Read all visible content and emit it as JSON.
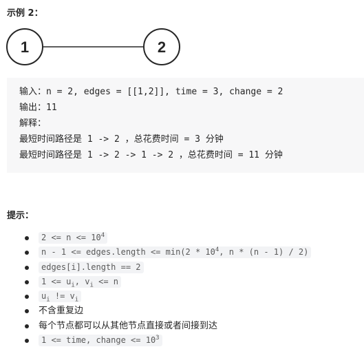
{
  "example": {
    "heading": "示例 2：",
    "graph": {
      "nodes": [
        "1",
        "2"
      ],
      "edges": [
        [
          "1",
          "2"
        ]
      ]
    },
    "code_lines": [
      "输入：n = 2, edges = [[1,2]], time = 3, change = 2",
      "输出：11",
      "解释：",
      "最短时间路径是 1 -> 2 ，总花费时间 = 3 分钟",
      "最短时间路径是 1 -> 2 -> 1 -> 2 ，总花费时间 = 11 分钟"
    ]
  },
  "hints": {
    "heading": "提示：",
    "items": [
      {
        "type": "code",
        "parts": [
          {
            "t": "2 <= n <= 10"
          },
          {
            "sup": "4"
          }
        ]
      },
      {
        "type": "code",
        "parts": [
          {
            "t": "n - 1 <= edges.length <= min(2 * 10"
          },
          {
            "sup": "4"
          },
          {
            "t": ", n * (n - 1) / 2)"
          }
        ]
      },
      {
        "type": "code",
        "parts": [
          {
            "t": "edges[i].length == 2"
          }
        ]
      },
      {
        "type": "code",
        "parts": [
          {
            "t": "1 <= u"
          },
          {
            "sub": "i"
          },
          {
            "t": ", v"
          },
          {
            "sub": "i"
          },
          {
            "t": " <= n"
          }
        ]
      },
      {
        "type": "code",
        "parts": [
          {
            "t": "u"
          },
          {
            "sub": "i"
          },
          {
            "t": " != v"
          },
          {
            "sub": "i"
          }
        ]
      },
      {
        "type": "text",
        "text": "不含重复边"
      },
      {
        "type": "text",
        "text": "每个节点都可以从其他节点直接或者间接到达"
      },
      {
        "type": "code",
        "parts": [
          {
            "t": "1 <= time, change <= 10"
          },
          {
            "sup": "3"
          }
        ]
      }
    ]
  }
}
